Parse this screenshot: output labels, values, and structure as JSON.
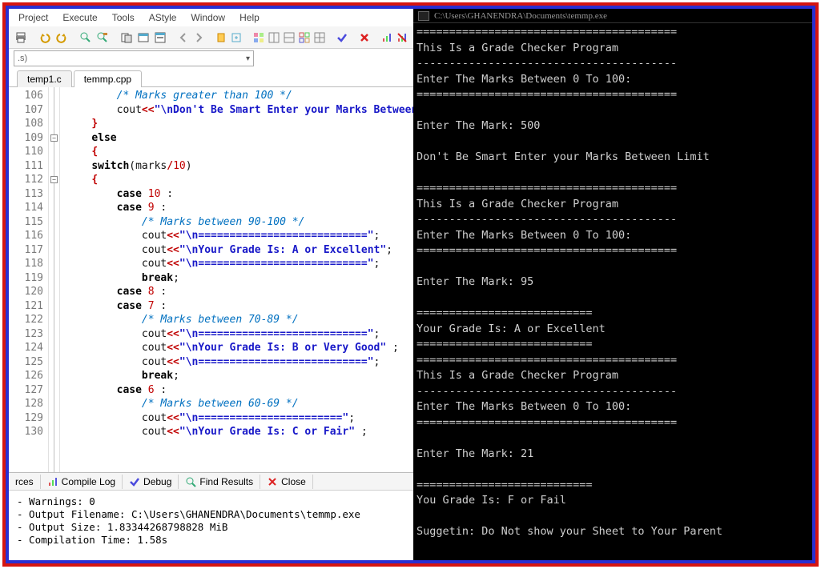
{
  "menu": [
    "Project",
    "Execute",
    "Tools",
    "AStyle",
    "Window",
    "Help"
  ],
  "combo": {
    "text": ".s)"
  },
  "tabs": [
    {
      "label": "temp1.c",
      "active": false
    },
    {
      "label": "temmp.cpp",
      "active": true
    }
  ],
  "code_lines": [
    {
      "n": 106,
      "html": "        <span class='cmt'>/* Marks greater than 100 */</span>"
    },
    {
      "n": 107,
      "html": "        cout<span class='op'>&lt;&lt;</span><span class='str'>\"\\nDon't Be Smart Enter your Marks Between Limit\\n\"</span>;"
    },
    {
      "n": 108,
      "html": "    <span class='op'>}</span>"
    },
    {
      "n": 109,
      "html": "    <span class='kw'>else</span>",
      "fold": true
    },
    {
      "n": 110,
      "html": "    <span class='op'>{</span>"
    },
    {
      "n": 111,
      "html": "    <span class='kw'>switch</span>(marks<span class='op'>/</span><span class='num'>10</span>)"
    },
    {
      "n": 112,
      "html": "    <span class='op'>{</span>",
      "fold": true
    },
    {
      "n": 113,
      "html": "        <span class='kw'>case</span> <span class='num'>10</span> :"
    },
    {
      "n": 114,
      "html": "        <span class='kw'>case</span> <span class='num'>9</span> :"
    },
    {
      "n": 115,
      "html": "            <span class='cmt'>/* Marks between 90-100 */</span>"
    },
    {
      "n": 116,
      "html": "            cout<span class='op'>&lt;&lt;</span><span class='str'>\"\\n===========================\"</span>;"
    },
    {
      "n": 117,
      "html": "            cout<span class='op'>&lt;&lt;</span><span class='str'>\"\\nYour Grade Is: A or Excellent\"</span>;"
    },
    {
      "n": 118,
      "html": "            cout<span class='op'>&lt;&lt;</span><span class='str'>\"\\n===========================\"</span>;"
    },
    {
      "n": 119,
      "html": "            <span class='kw'>break</span>;"
    },
    {
      "n": 120,
      "html": "        <span class='kw'>case</span> <span class='num'>8</span> :"
    },
    {
      "n": 121,
      "html": "        <span class='kw'>case</span> <span class='num'>7</span> :"
    },
    {
      "n": 122,
      "html": "            <span class='cmt'>/* Marks between 70-89 */</span>"
    },
    {
      "n": 123,
      "html": "            cout<span class='op'>&lt;&lt;</span><span class='str'>\"\\n===========================\"</span>;"
    },
    {
      "n": 124,
      "html": "            cout<span class='op'>&lt;&lt;</span><span class='str'>\"\\nYour Grade Is: B or Very Good\"</span> ;"
    },
    {
      "n": 125,
      "html": "            cout<span class='op'>&lt;&lt;</span><span class='str'>\"\\n===========================\"</span>;"
    },
    {
      "n": 126,
      "html": "            <span class='kw'>break</span>;"
    },
    {
      "n": 127,
      "html": "        <span class='kw'>case</span> <span class='num'>6</span> :"
    },
    {
      "n": 128,
      "html": "            <span class='cmt'>/* Marks between 60-69 */</span>"
    },
    {
      "n": 129,
      "html": "            cout<span class='op'>&lt;&lt;</span><span class='str'>\"\\n=======================\"</span>;"
    },
    {
      "n": 130,
      "html": "            cout<span class='op'>&lt;&lt;</span><span class='str'>\"\\nYour Grade Is: C or Fair\"</span> ;"
    }
  ],
  "bottom_tabs": {
    "t1": "rces",
    "t2": "Compile Log",
    "t3": "Debug",
    "t4": "Find Results",
    "t5": "Close"
  },
  "log": [
    "- Warnings: 0",
    "- Output Filename: C:\\Users\\GHANENDRA\\Documents\\temmp.exe",
    "- Output Size: 1.83344268798828 MiB",
    "- Compilation Time: 1.58s"
  ],
  "console_title": "C:\\Users\\GHANENDRA\\Documents\\temmp.exe",
  "console": [
    "========================================",
    "This Is a Grade Checker Program",
    "----------------------------------------",
    "Enter The Marks Between 0 To 100:",
    "========================================",
    "",
    "Enter The Mark: 500",
    "",
    "Don't Be Smart Enter your Marks Between Limit",
    "",
    "========================================",
    "This Is a Grade Checker Program",
    "----------------------------------------",
    "Enter The Marks Between 0 To 100:",
    "========================================",
    "",
    "Enter The Mark: 95",
    "",
    "===========================",
    "Your Grade Is: A or Excellent",
    "===========================",
    "========================================",
    "This Is a Grade Checker Program",
    "----------------------------------------",
    "Enter The Marks Between 0 To 100:",
    "========================================",
    "",
    "Enter The Mark: 21",
    "",
    "===========================",
    "You Grade Is: F or Fail",
    "",
    "Suggetin: Do Not show your Sheet to Your Parent"
  ]
}
